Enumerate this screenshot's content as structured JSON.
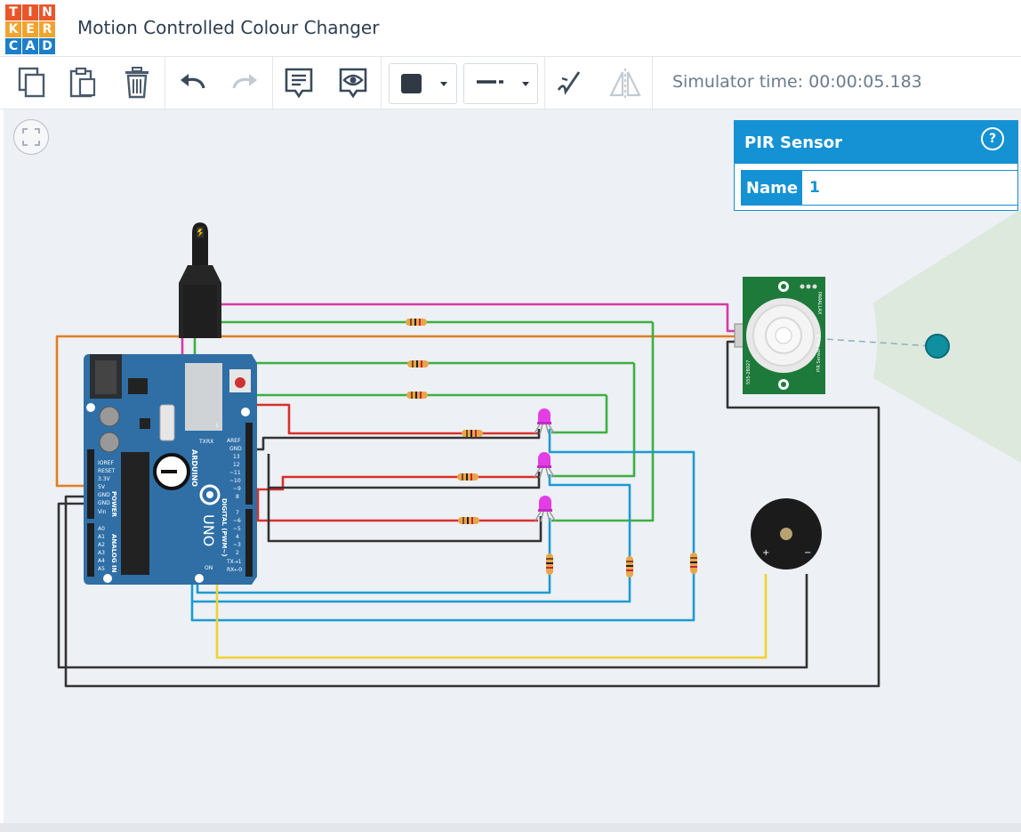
{
  "app": {
    "logo_letters": [
      "T",
      "I",
      "N",
      "K",
      "E",
      "R",
      "C",
      "A",
      "D"
    ],
    "logo_colors": [
      "#e8562a",
      "#e8562a",
      "#e8562a",
      "#f0a430",
      "#f0a430",
      "#f0a430",
      "#1c7fc8",
      "#1c7fc8",
      "#1c7fc8"
    ],
    "project_title": "Motion Controlled Colour Changer"
  },
  "toolbar": {
    "buttons": [
      "copy-icon",
      "paste-icon",
      "delete-icon",
      "undo-icon",
      "redo-icon",
      "notes-icon",
      "notes-visibility-icon",
      "color-swatch",
      "line-style",
      "pen-icon",
      "flip-icon"
    ],
    "simulator_time": "Simulator time: 00:00:05.183"
  },
  "inspector": {
    "title": "PIR Sensor",
    "help": "?",
    "fields": [
      {
        "key": "Name",
        "value": "1"
      }
    ]
  },
  "board": {
    "labels_power": [
      "IOREF",
      "RESET",
      "3.3V",
      "5V",
      "GND",
      "GND",
      "Vin"
    ],
    "label_power": "POWER",
    "labels_analog": [
      "A0",
      "A1",
      "A2",
      "A3",
      "A4",
      "A5"
    ],
    "label_analog": "ANALOG IN",
    "labels_digital": [
      "AREF",
      "GND",
      "13",
      "12",
      "~11",
      "~10",
      "~9",
      "8",
      "7",
      "~6",
      "~5",
      "4",
      "~3",
      "2",
      "TX→1",
      "RX←0"
    ],
    "label_digital": "DIGITAL (PWM~)",
    "label_uno": "UNO",
    "label_on": "ON",
    "label_l": "L",
    "label_tx": "TX",
    "label_rx": "RX",
    "label_brand": "ARDUINO"
  },
  "sensor": {
    "labels": [
      "PARALLAX",
      "555-28027",
      "PIR Sensor Rev B"
    ]
  },
  "buzzer": {
    "plus": "+",
    "minus": "−"
  },
  "colors": {
    "wire_pink": "#d63aa5",
    "wire_green": "#3cb043",
    "wire_orange": "#e47d1f",
    "wire_red": "#d8302c",
    "wire_blue": "#1b9bd1",
    "wire_yellow": "#f0d231",
    "wire_black": "#333333",
    "board_blue": "#2f6fa6",
    "led_magenta": "#e33ee6",
    "pir_green": "#1d7a3a",
    "accent": "#1492d3"
  }
}
